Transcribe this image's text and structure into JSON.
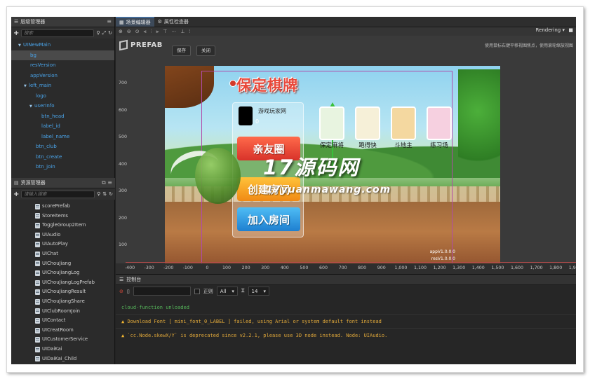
{
  "hierarchy": {
    "title": "层级管理器",
    "search_placeholder": "搜索",
    "items": [
      {
        "label": "UINewMain",
        "arrow": "▼",
        "indent": 10,
        "selected": false
      },
      {
        "label": "bg",
        "arrow": "",
        "indent": 20,
        "selected": true
      },
      {
        "label": "resVersion",
        "arrow": "",
        "indent": 20,
        "selected": false
      },
      {
        "label": "appVersion",
        "arrow": "",
        "indent": 20,
        "selected": false
      },
      {
        "label": "left_main",
        "arrow": "▼",
        "indent": 18,
        "selected": false
      },
      {
        "label": "logo",
        "arrow": "",
        "indent": 28,
        "selected": false
      },
      {
        "label": "userInfo",
        "arrow": "▼",
        "indent": 26,
        "selected": false
      },
      {
        "label": "btn_head",
        "arrow": "",
        "indent": 36,
        "selected": false
      },
      {
        "label": "label_id",
        "arrow": "",
        "indent": 36,
        "selected": false
      },
      {
        "label": "label_name",
        "arrow": "",
        "indent": 36,
        "selected": false
      },
      {
        "label": "btn_club",
        "arrow": "",
        "indent": 28,
        "selected": false
      },
      {
        "label": "btn_create",
        "arrow": "",
        "indent": 28,
        "selected": false
      },
      {
        "label": "btn_join",
        "arrow": "",
        "indent": 28,
        "selected": false
      }
    ]
  },
  "assets": {
    "title": "资源管理器",
    "search_placeholder": "请输入搜索",
    "items": [
      "scorePrefab",
      "StoreItems",
      "ToggleGroup2Item",
      "UIAudio",
      "UIAutoPlay",
      "UIChat",
      "UIChouJiang",
      "UIChouJiangLog",
      "UIChouJiangLogPrefab",
      "UIChouJiangResult",
      "UIChouJiangShare",
      "UIClubRoomJoin",
      "UIContact",
      "UICreatRoom",
      "UICustomerService",
      "UIDaiKai",
      "UIDaiKai_Child"
    ]
  },
  "main_tabs": [
    {
      "label": "场景编辑器",
      "active": true,
      "icon": "scene-icon"
    },
    {
      "label": "属性检查器",
      "active": false,
      "icon": "gear-icon"
    }
  ],
  "scene_toolbar": {
    "rendering_label": "Rendering",
    "hint": "使用鼠标右键平移视图焦点，使用滚轮缩放视图"
  },
  "prefab": {
    "label": "PREFAB",
    "save_label": "保存",
    "close_label": "关闭"
  },
  "ruler": {
    "y_labels": [
      "700",
      "600",
      "500",
      "400",
      "300",
      "200",
      "100",
      "0"
    ],
    "x_labels": [
      "-400",
      "-300",
      "-200",
      "-100",
      "0",
      "100",
      "200",
      "300",
      "400",
      "500",
      "600",
      "700",
      "800",
      "900",
      "1,000",
      "1,100",
      "1,200",
      "1,300",
      "1,400",
      "1,500",
      "1,600",
      "1,700",
      "1,800",
      "1,900"
    ]
  },
  "game": {
    "title": "保定棋牌",
    "username": "游戏玩家网",
    "user_id": "0",
    "btn_club": "亲友圈",
    "btn_create": "创建房间",
    "btn_join": "加入房间",
    "modes": [
      {
        "label": "保定麻将",
        "color": "#e8f4e0"
      },
      {
        "label": "跑得快",
        "color": "#f6f0d8"
      },
      {
        "label": "斗地主",
        "color": "#f4d8a0"
      },
      {
        "label": "练习场",
        "color": "#f6d0e0"
      }
    ],
    "app_version": "appV1.0.0.0",
    "res_version": "resV1.0.0.0"
  },
  "watermark": {
    "main": "17源码网",
    "sub": "17yuanmawang.com"
  },
  "console": {
    "title": "控制台",
    "regex_label": "正则",
    "level_value": "All",
    "font_size_value": "14",
    "logs": [
      {
        "type": "info",
        "text": "cloud-function unloaded"
      },
      {
        "type": "warn",
        "text": "Download Font [ mini_font_0_LABEL ] failed, using Arial or system default font instead"
      },
      {
        "type": "warn",
        "text": "`cc.Node.skewX/Y` is deprecated since v2.2.1, please use 3D node instead. Node: UIAudio."
      }
    ]
  },
  "colors": {
    "accent": "#4aa3e8",
    "warn": "#e0a83a",
    "log_info": "#55b45a"
  }
}
